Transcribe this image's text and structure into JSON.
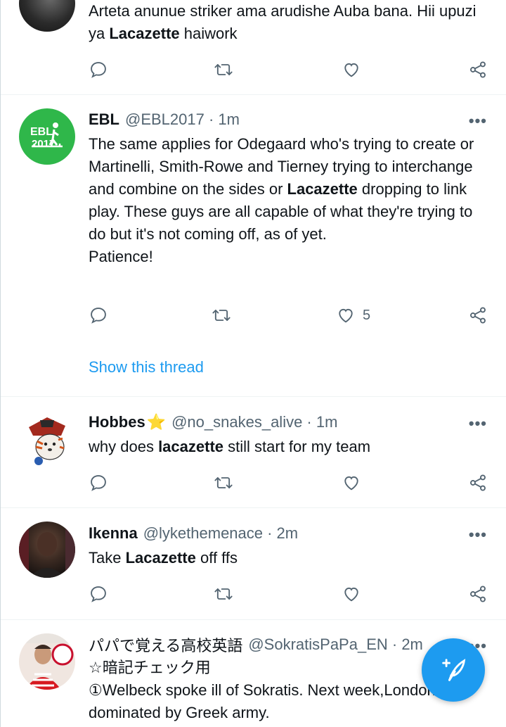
{
  "tweets": [
    {
      "text_plain_1": "Arteta anunue striker ama arudishe Auba bana. Hii upuzi ya ",
      "keyword": "Lacazette",
      "text_plain_2": " haiwork"
    },
    {
      "name": "EBL",
      "handle": "@EBL2017 · 1m",
      "avatar_text_1": "EBL",
      "avatar_text_2": "2017",
      "text_plain_1": "The same applies for Odegaard who's trying to create or Martinelli, Smith-Rowe and Tierney trying to interchange and combine on the sides or ",
      "keyword": "Lacazette",
      "text_plain_2": " dropping to link play. These guys are all capable of what they're trying to do but it's not coming off, as of yet.",
      "text_line_3": "Patience!",
      "like_count": "5",
      "show_thread": "Show this thread"
    },
    {
      "name": "Hobbes",
      "name_emoji": "⭐",
      "handle": "@no_snakes_alive · 1m",
      "text_plain_1": "why does ",
      "keyword": "lacazette",
      "text_plain_2": " still start for my team"
    },
    {
      "name": "Ikenna",
      "handle": "@lykethemenace · 2m",
      "text_plain_1": "Take ",
      "keyword": "Lacazette",
      "text_plain_2": " off ffs"
    },
    {
      "name": "パパで覚える高校英語",
      "handle": "@SokratisPaPa_EN · 2m",
      "text_line_1": "☆暗記チェック用",
      "text_line_2": "①Welbeck spoke ill of Sokratis. Next week,London was dominated by Greek army."
    }
  ],
  "more_glyph": "•••",
  "colors": {
    "accent": "#1d9bf0",
    "secondary_text": "#536471",
    "ebl_avatar_bg": "#2fb74a"
  },
  "icons": [
    "reply-icon",
    "retweet-icon",
    "like-icon",
    "share-icon",
    "compose-tweet-icon",
    "more-icon"
  ]
}
